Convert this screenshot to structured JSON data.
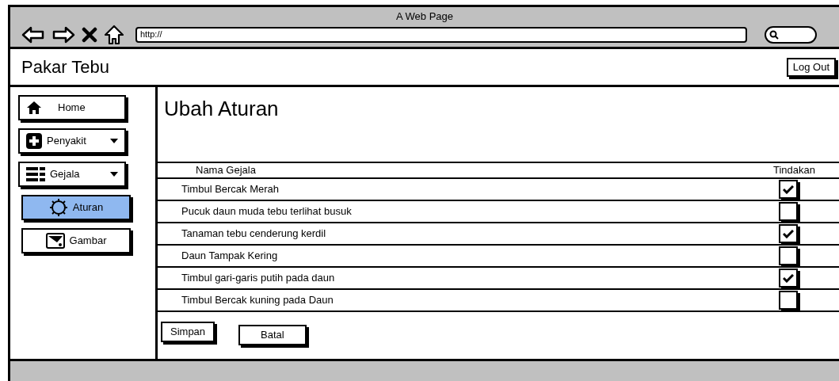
{
  "window": {
    "title": "A Web Page"
  },
  "browser": {
    "url": "http://"
  },
  "header": {
    "title": "Pakar Tebu",
    "logout": "Log Out"
  },
  "sidebar": {
    "items": [
      {
        "label": "Home",
        "dropdown": false,
        "selected": false
      },
      {
        "label": "Penyakit",
        "dropdown": true,
        "selected": false
      },
      {
        "label": "Gejala",
        "dropdown": true,
        "selected": false
      },
      {
        "label": "Aturan",
        "dropdown": false,
        "selected": true
      },
      {
        "label": "Gambar",
        "dropdown": false,
        "selected": false
      }
    ]
  },
  "content": {
    "title": "Ubah Aturan",
    "table": {
      "columns": [
        "Nama Gejala",
        "Tindakan"
      ],
      "rows": [
        {
          "name": "Timbul Bercak Merah",
          "checked": true
        },
        {
          "name": "Pucuk daun muda tebu terlihat busuk",
          "checked": false
        },
        {
          "name": "Tanaman tebu cenderung kerdil",
          "checked": true
        },
        {
          "name": "Daun Tampak Kering",
          "checked": false
        },
        {
          "name": "Timbul gari-garis putih pada daun",
          "checked": true
        },
        {
          "name": "Timbul Bercak kuning pada Daun",
          "checked": false
        }
      ]
    },
    "buttons": [
      "Simpan",
      "Batal"
    ]
  }
}
